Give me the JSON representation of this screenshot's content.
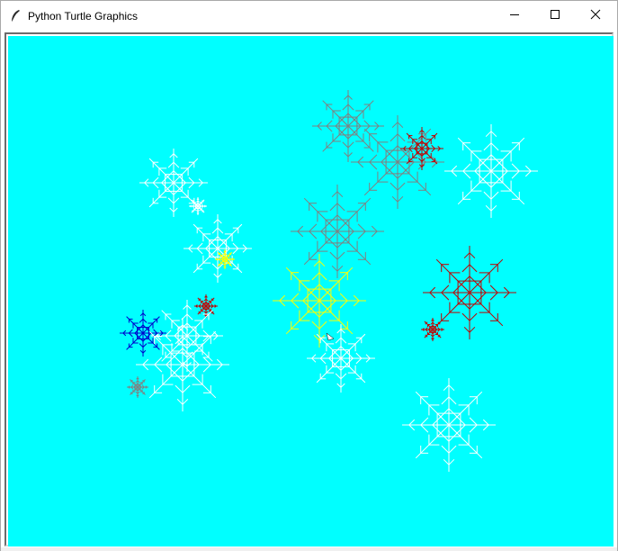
{
  "window": {
    "title": "Python Turtle Graphics",
    "controls": [
      "minimize",
      "maximize",
      "close"
    ],
    "icon": "feather-icon"
  },
  "canvas": {
    "background": "#00ffff",
    "snowflake_colors": {
      "white": "#ffffff",
      "gray": "#808080",
      "red": "#c00000",
      "blue": "#0000cc",
      "yellow": "#ffff00"
    },
    "turtle_icon": "arrow-cursor-icon"
  }
}
